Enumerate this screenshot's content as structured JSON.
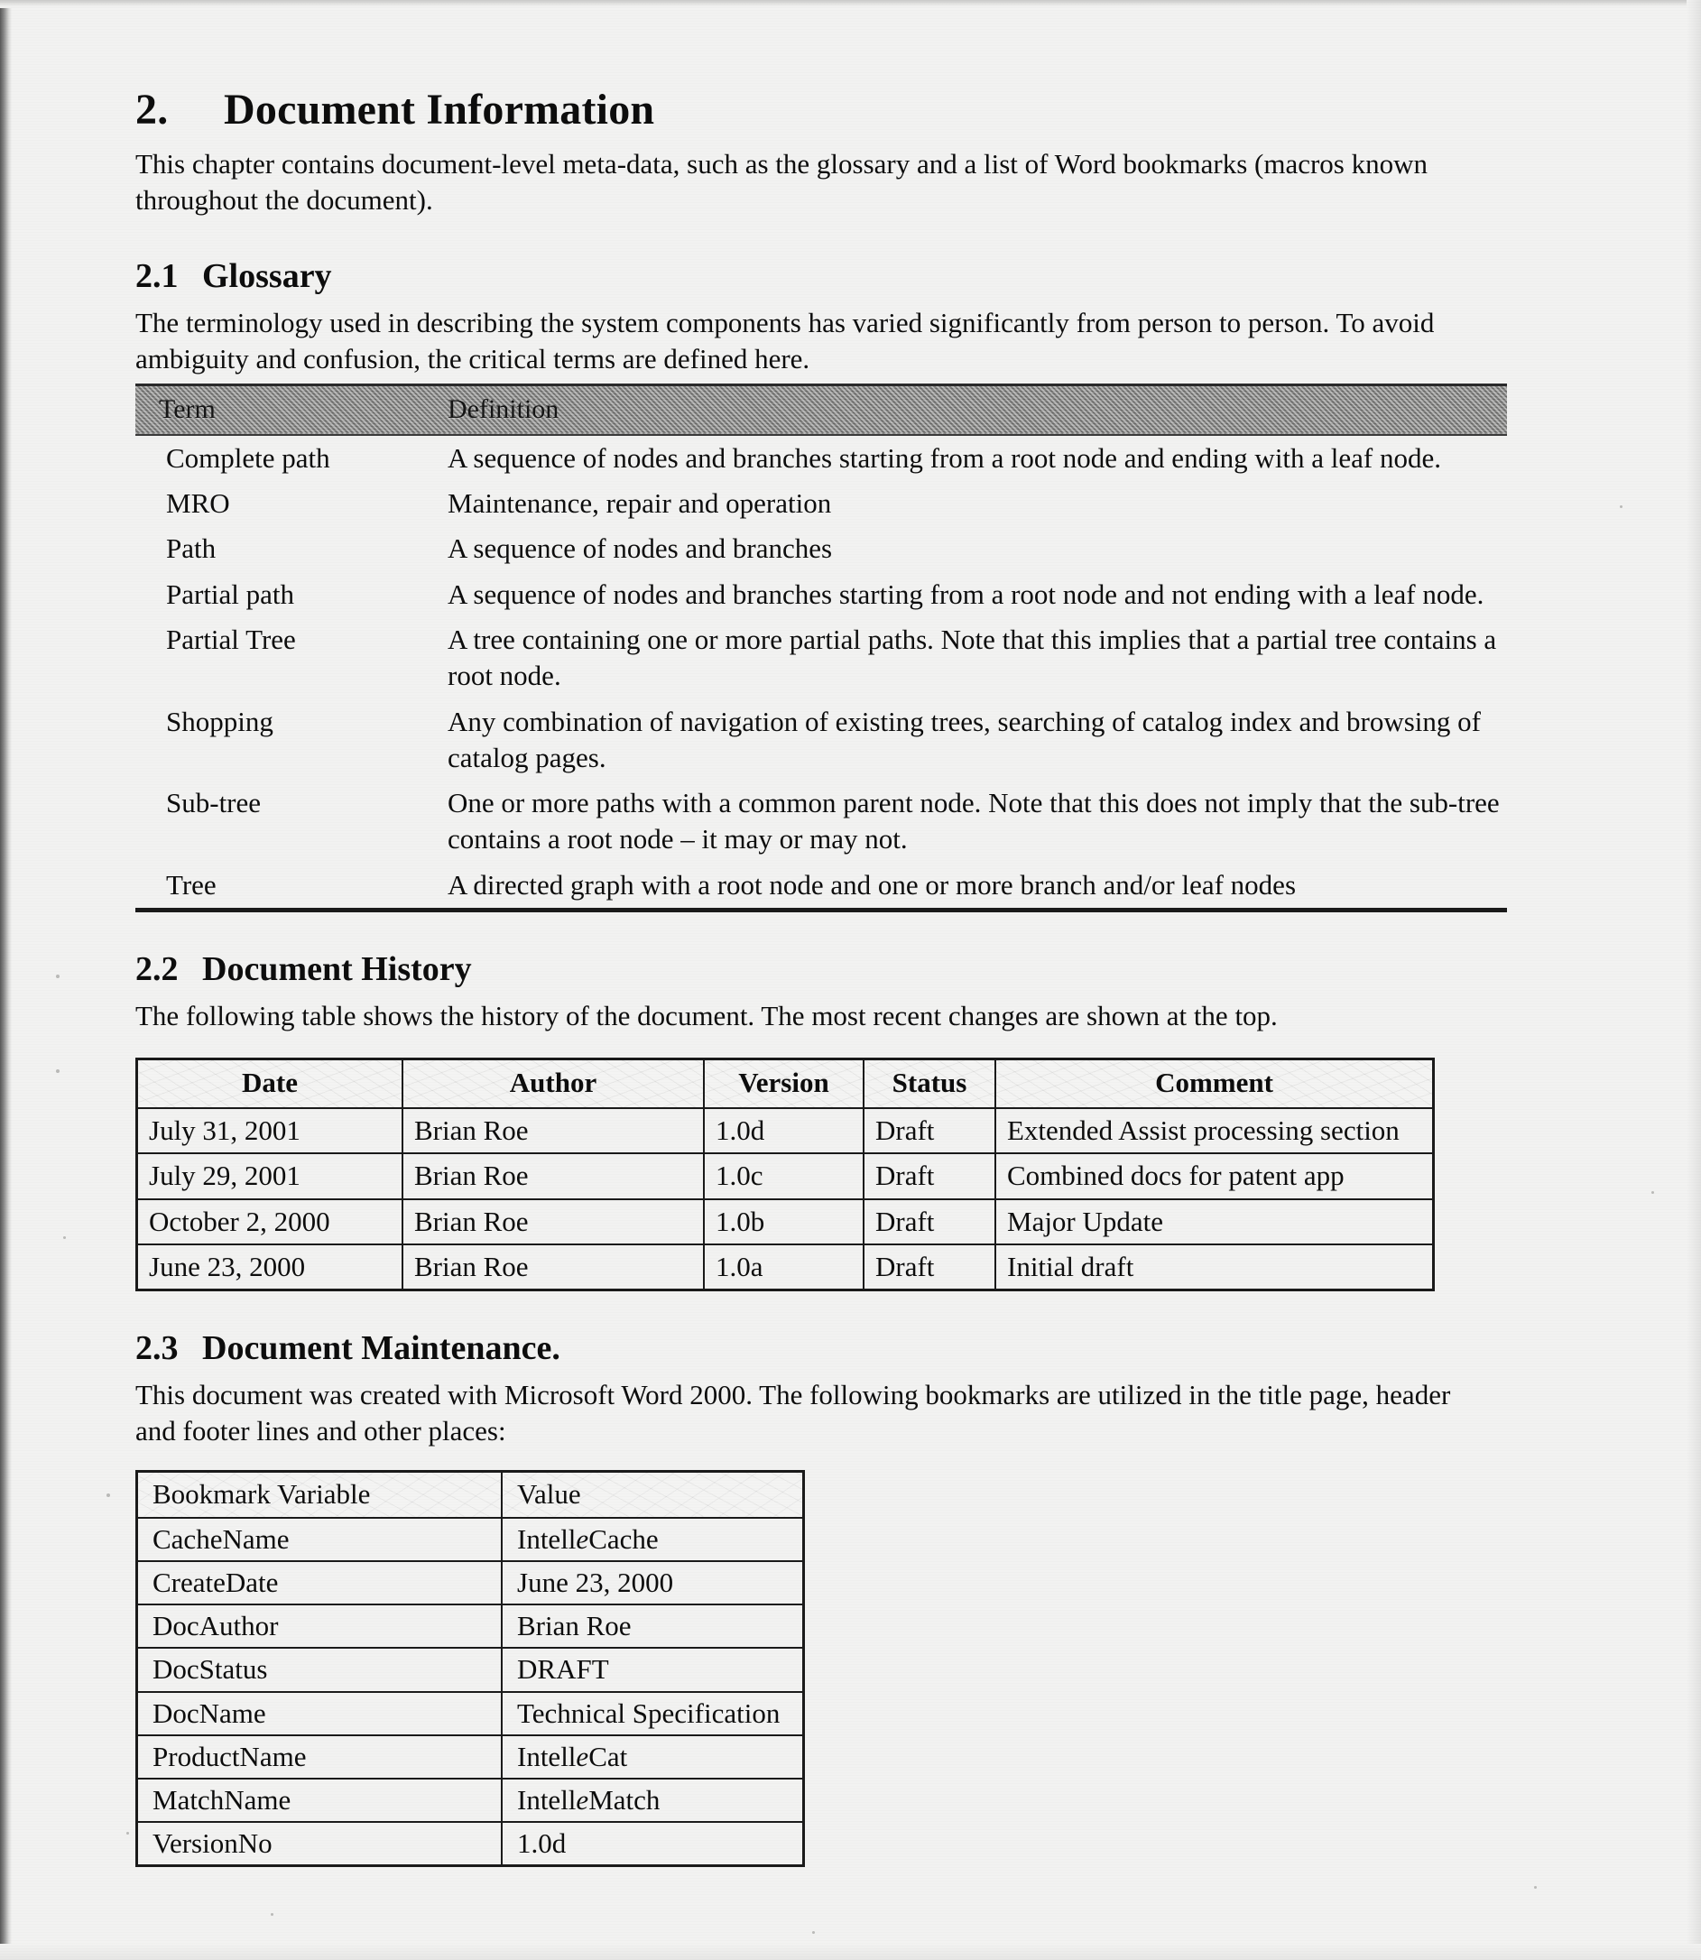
{
  "chapter": {
    "number": "2.",
    "title": "Document Information",
    "intro": "This chapter contains document-level meta-data, such as the glossary and a list of Word bookmarks (macros known throughout the document)."
  },
  "glossary": {
    "number": "2.1",
    "title": "Glossary",
    "intro": "The terminology used in describing the system components has varied significantly from person to person.  To avoid ambiguity and confusion, the critical terms are defined here.",
    "columns": [
      "Term",
      "Definition"
    ],
    "rows": [
      {
        "term": "Complete path",
        "definition": "A sequence of nodes and branches starting from a root node and ending with a leaf node."
      },
      {
        "term": "MRO",
        "definition": "Maintenance, repair and operation"
      },
      {
        "term": "Path",
        "definition": "A sequence of nodes and branches"
      },
      {
        "term": "Partial path",
        "definition": "A sequence of nodes and branches starting from a root node and not ending with a leaf node."
      },
      {
        "term": "Partial Tree",
        "definition": "A tree containing one or more partial paths.  Note that this implies that a partial tree contains a root node."
      },
      {
        "term": "Shopping",
        "definition": "Any combination of navigation of existing trees, searching of catalog index and browsing of catalog pages."
      },
      {
        "term": "Sub-tree",
        "definition": "One or more paths with a common parent node.  Note that this does not imply that the sub-tree contains a root node – it may or may not."
      },
      {
        "term": "Tree",
        "definition": "A directed graph with a root node and one or more branch and/or leaf nodes"
      }
    ]
  },
  "history": {
    "number": "2.2",
    "title": "Document History",
    "intro": "The following table shows the history of the document.  The most recent changes are shown at the top.",
    "columns": [
      "Date",
      "Author",
      "Version",
      "Status",
      "Comment"
    ],
    "rows": [
      {
        "date": "July 31, 2001",
        "author": "Brian Roe",
        "version": "1.0d",
        "status": "Draft",
        "comment": "Extended Assist processing section"
      },
      {
        "date": "July 29, 2001",
        "author": "Brian Roe",
        "version": "1.0c",
        "status": "Draft",
        "comment": "Combined docs for patent app"
      },
      {
        "date": "October 2, 2000",
        "author": "Brian Roe",
        "version": "1.0b",
        "status": "Draft",
        "comment": "Major Update"
      },
      {
        "date": "June 23, 2000",
        "author": "Brian Roe",
        "version": "1.0a",
        "status": "Draft",
        "comment": "Initial draft"
      }
    ]
  },
  "maintenance": {
    "number": "2.3",
    "title": "Document Maintenance.",
    "intro": "This document was created with Microsoft Word 2000. The following bookmarks are utilized in the title page, header and footer lines and other places:",
    "columns": [
      "Bookmark Variable",
      "Value"
    ],
    "rows": [
      {
        "variable": "CacheName",
        "value_pre": "Intell",
        "value_em": "e",
        "value_post": "Cache"
      },
      {
        "variable": "CreateDate",
        "value_pre": "June 23, 2000",
        "value_em": "",
        "value_post": ""
      },
      {
        "variable": "DocAuthor",
        "value_pre": "Brian Roe",
        "value_em": "",
        "value_post": ""
      },
      {
        "variable": "DocStatus",
        "value_pre": "DRAFT",
        "value_em": "",
        "value_post": ""
      },
      {
        "variable": "DocName",
        "value_pre": "Technical Specification",
        "value_em": "",
        "value_post": ""
      },
      {
        "variable": "ProductName",
        "value_pre": "Intell",
        "value_em": "e",
        "value_post": "Cat"
      },
      {
        "variable": "MatchName",
        "value_pre": "Intell",
        "value_em": "e",
        "value_post": "Match"
      },
      {
        "variable": "VersionNo",
        "value_pre": "1.0d",
        "value_em": "",
        "value_post": ""
      }
    ]
  }
}
